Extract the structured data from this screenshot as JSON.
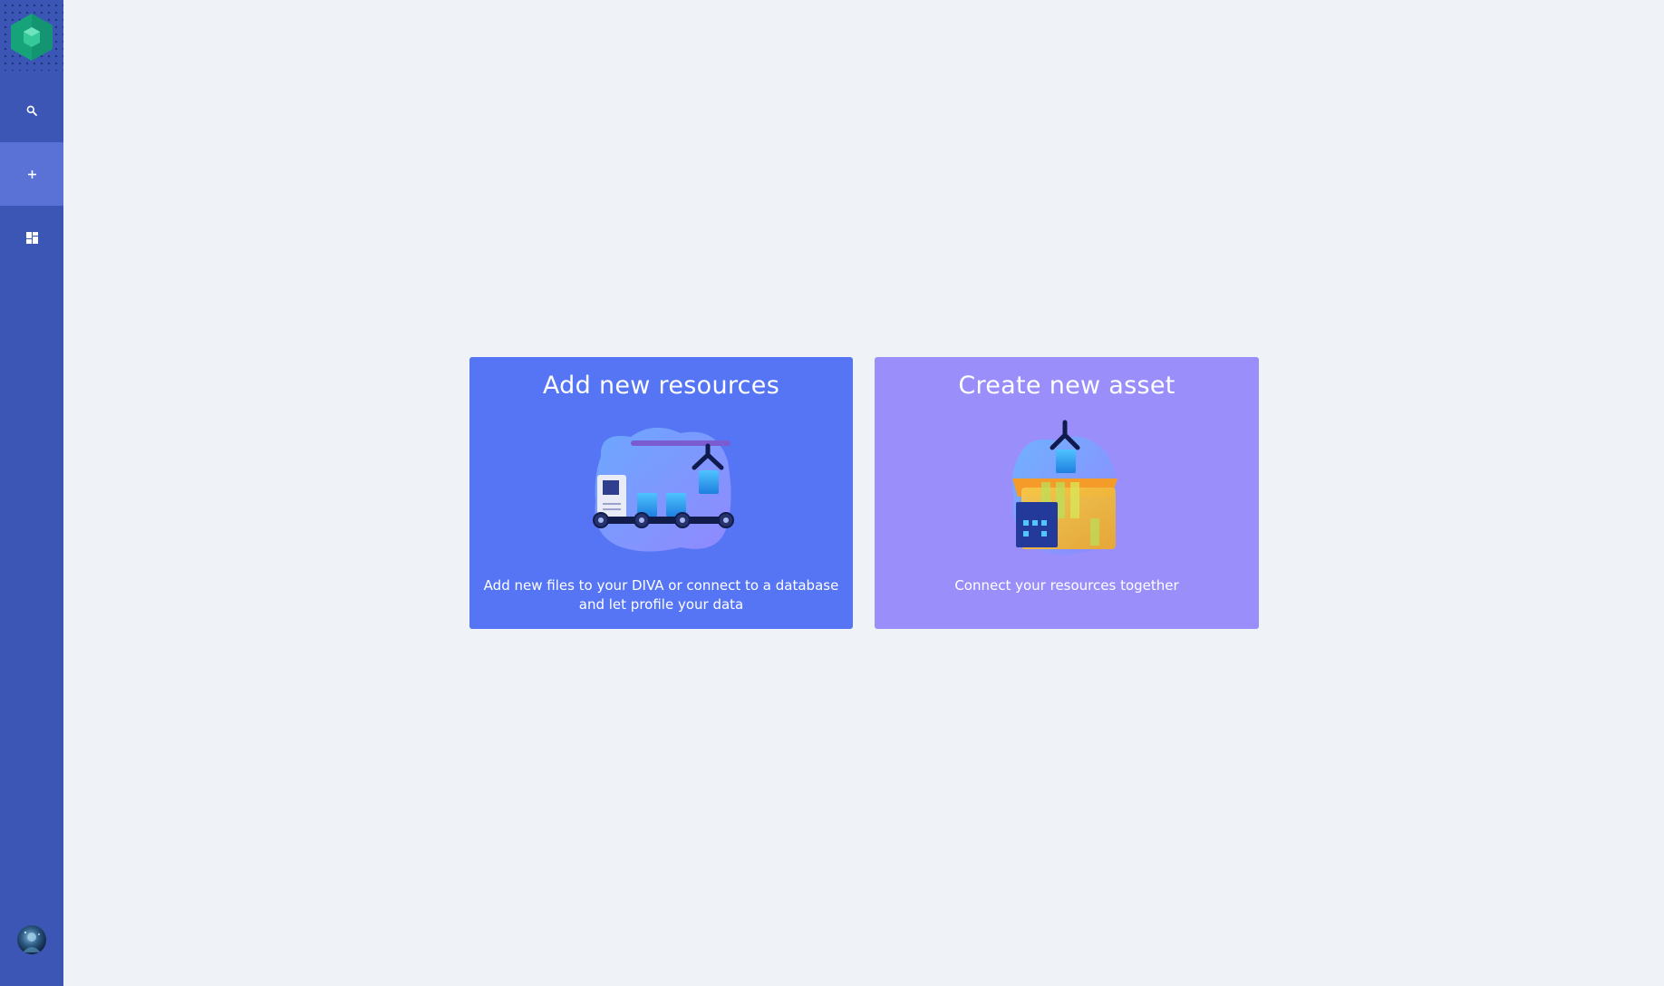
{
  "sidebar": {
    "logo_icon": "hexagon-logo-icon",
    "items": [
      {
        "name": "search",
        "icon": "search-icon",
        "active": false
      },
      {
        "name": "add",
        "icon": "plus-icon",
        "active": true
      },
      {
        "name": "dashboard",
        "icon": "dashboard-icon",
        "active": false
      }
    ],
    "avatar_icon": "user-avatar"
  },
  "cards": {
    "add_resources": {
      "title": "Add new resources",
      "description": "Add new files to your DIVA or connect to a database and let profile your data",
      "color": "#5675f5"
    },
    "create_asset": {
      "title": "Create new asset",
      "description": "Connect your resources together",
      "color": "#9a8efb"
    }
  },
  "colors": {
    "background": "#eff3f8",
    "sidebar": "#3b56b5",
    "sidebar_active": "#5a72d6",
    "logo": "#1aa67a"
  }
}
